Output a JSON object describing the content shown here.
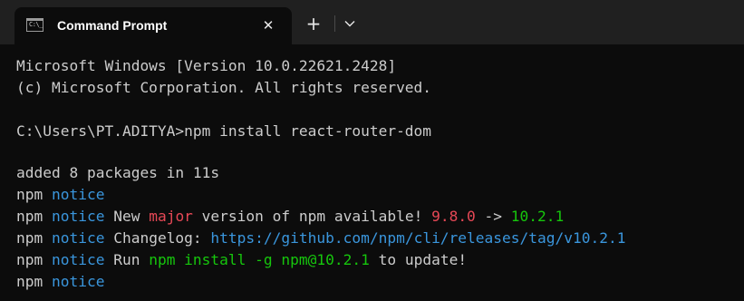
{
  "window": {
    "tab": {
      "title": "Command Prompt",
      "icon": "cmd-icon",
      "icon_glyph": "C:\\_",
      "close_glyph": "✕"
    },
    "new_tab_glyph": "+",
    "dropdown_icon": "chevron-down-icon"
  },
  "terminal": {
    "colors": {
      "background": "#0c0c0c",
      "text": "#cccccc",
      "blue": "#3a96dd",
      "red": "#e74856",
      "green": "#16c60c"
    },
    "lines": [
      {
        "segments": [
          {
            "text": "Microsoft Windows [Version 10.0.22621.2428]",
            "color": "default"
          }
        ]
      },
      {
        "segments": [
          {
            "text": "(c) Microsoft Corporation. All rights reserved.",
            "color": "default"
          }
        ]
      },
      {
        "segments": [
          {
            "text": "C:\\Users\\PT.ADITYA>npm install react-router-dom",
            "color": "default"
          }
        ]
      },
      {
        "segments": [
          {
            "text": "added 8 packages in 11s",
            "color": "default"
          }
        ]
      },
      {
        "segments": [
          {
            "text": "npm ",
            "color": "default"
          },
          {
            "text": "notice",
            "color": "blue"
          }
        ]
      },
      {
        "segments": [
          {
            "text": "npm ",
            "color": "default"
          },
          {
            "text": "notice",
            "color": "blue"
          },
          {
            "text": " New ",
            "color": "default"
          },
          {
            "text": "major",
            "color": "red"
          },
          {
            "text": " version of npm available! ",
            "color": "default"
          },
          {
            "text": "9.8.0",
            "color": "red"
          },
          {
            "text": " -> ",
            "color": "default"
          },
          {
            "text": "10.2.1",
            "color": "green"
          }
        ]
      },
      {
        "segments": [
          {
            "text": "npm ",
            "color": "default"
          },
          {
            "text": "notice",
            "color": "blue"
          },
          {
            "text": " Changelog: ",
            "color": "default"
          },
          {
            "text": "https://github.com/npm/cli/releases/tag/v10.2.1",
            "color": "blue"
          }
        ]
      },
      {
        "segments": [
          {
            "text": "npm ",
            "color": "default"
          },
          {
            "text": "notice",
            "color": "blue"
          },
          {
            "text": " Run ",
            "color": "default"
          },
          {
            "text": "npm install -g npm@10.2.1",
            "color": "green"
          },
          {
            "text": " to update!",
            "color": "default"
          }
        ]
      },
      {
        "segments": [
          {
            "text": "npm ",
            "color": "default"
          },
          {
            "text": "notice",
            "color": "blue"
          }
        ]
      }
    ]
  }
}
